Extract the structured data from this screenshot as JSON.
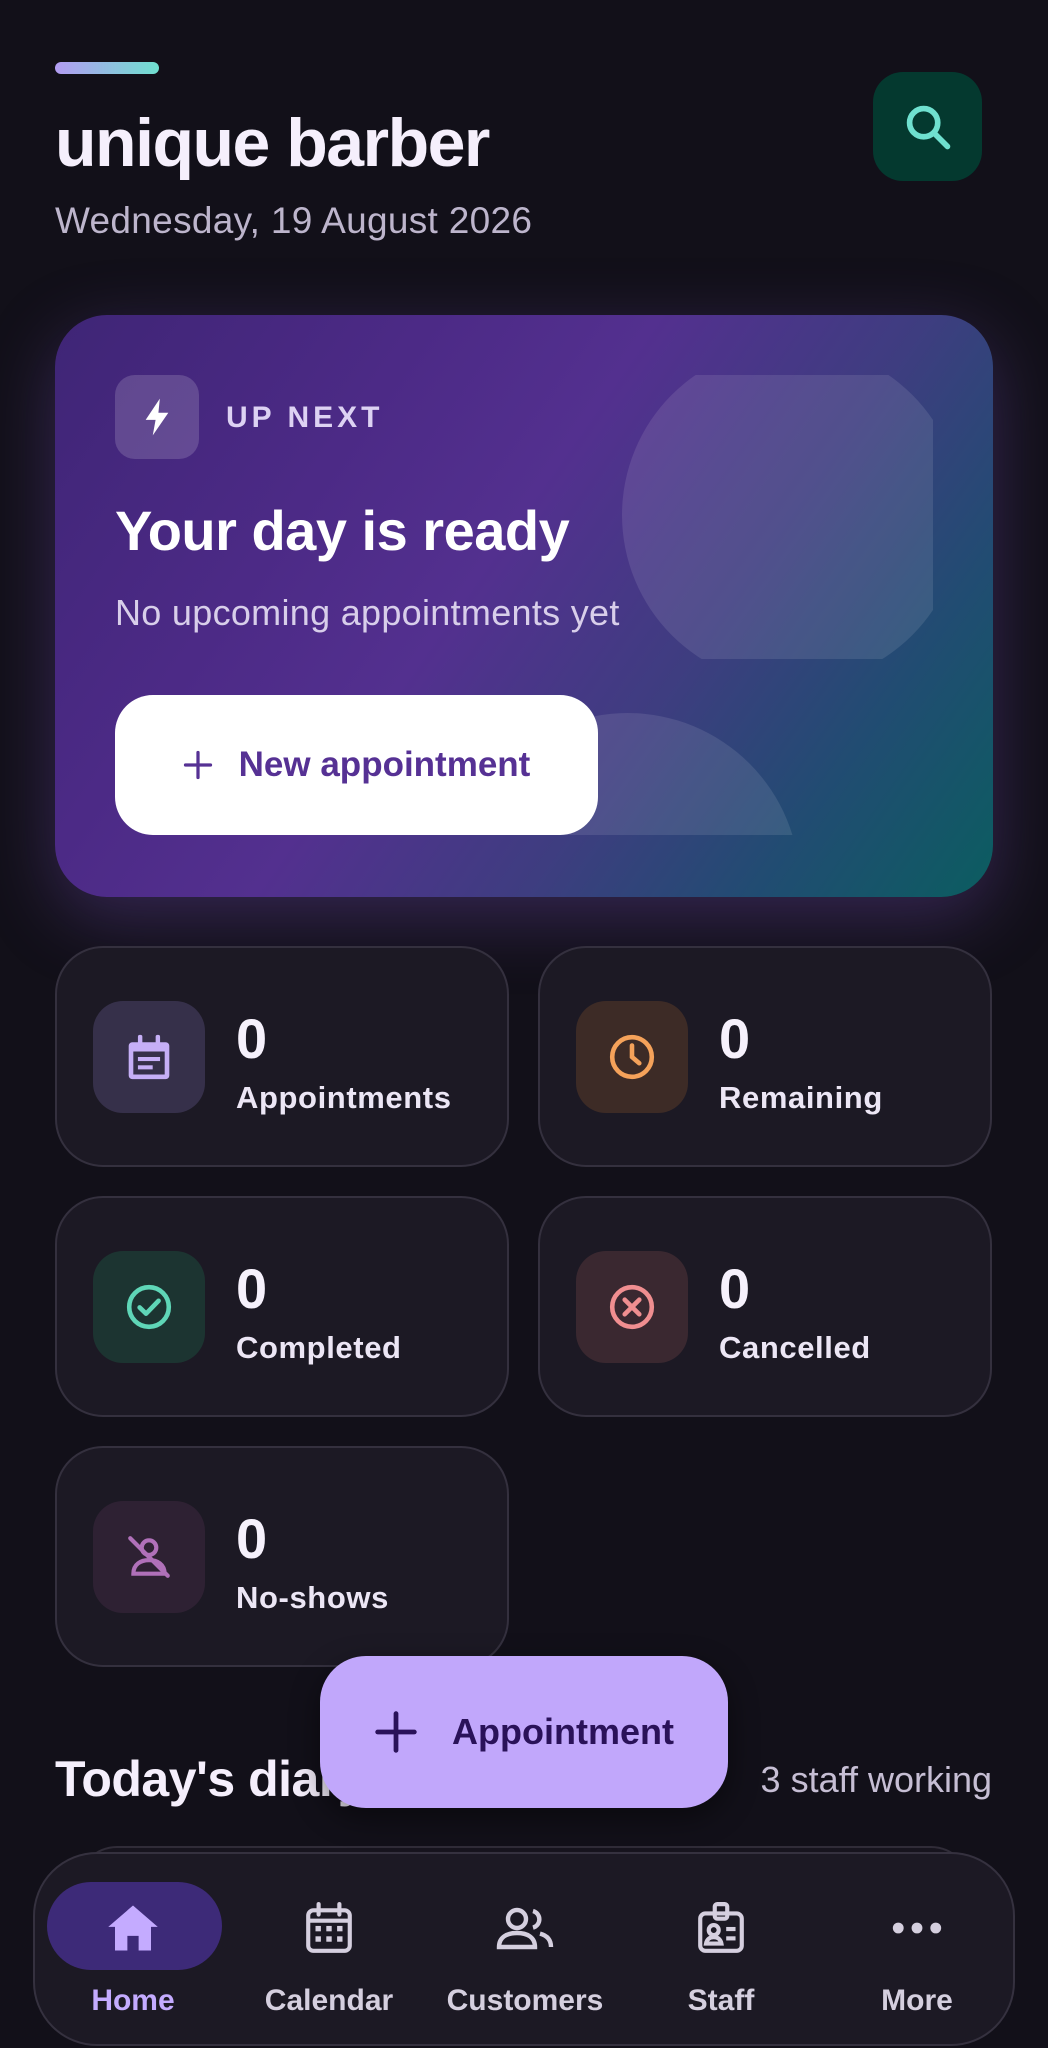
{
  "header": {
    "title": "unique barber",
    "date": "Wednesday, 19 August 2026",
    "search_icon": "search-icon"
  },
  "hero": {
    "kicker": "UP NEXT",
    "title": "Your day is ready",
    "subtitle": "No upcoming appointments yet",
    "button_label": "New appointment",
    "icon": "bolt-icon"
  },
  "stats": [
    {
      "value": "0",
      "label": "Appointments",
      "icon": "calendar-icon",
      "color": "#c6aff7"
    },
    {
      "value": "0",
      "label": "Remaining",
      "icon": "clock-icon",
      "color": "#f5a25a"
    },
    {
      "value": "0",
      "label": "Completed",
      "icon": "check-circle-icon",
      "color": "#5fd6b7"
    },
    {
      "value": "0",
      "label": "Cancelled",
      "icon": "cancel-circle-icon",
      "color": "#f08e90"
    },
    {
      "value": "0",
      "label": "No-shows",
      "icon": "no-show-icon",
      "color": "#b070b9"
    }
  ],
  "diary": {
    "title": "Today's diary",
    "meta": "3 staff working"
  },
  "fab": {
    "label": "Appointment"
  },
  "nav": {
    "items": [
      {
        "label": "Home",
        "icon": "home-icon",
        "active": true
      },
      {
        "label": "Calendar",
        "icon": "calendar-grid-icon",
        "active": false
      },
      {
        "label": "Customers",
        "icon": "people-icon",
        "active": false
      },
      {
        "label": "Staff",
        "icon": "badge-icon",
        "active": false
      },
      {
        "label": "More",
        "icon": "more-icon",
        "active": false
      }
    ]
  },
  "colors": {
    "background": "#121019",
    "accent": "#c1a7fb",
    "teal": "#6fe0cf"
  }
}
